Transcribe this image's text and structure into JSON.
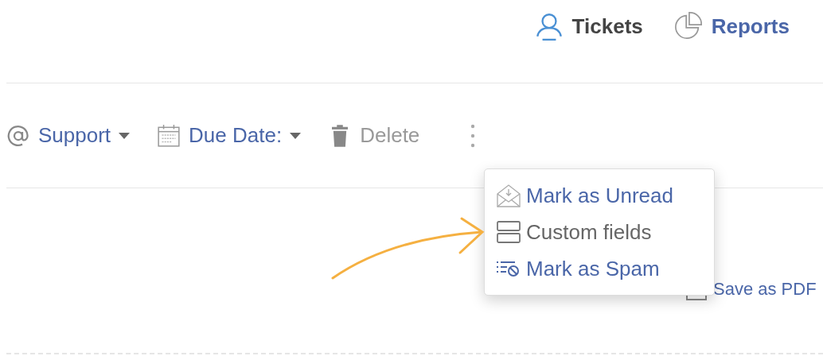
{
  "nav": [
    {
      "label": "Tickets",
      "kind": "person",
      "selected": true
    },
    {
      "label": "Reports",
      "kind": "pie",
      "selected": false
    }
  ],
  "toolbar": [
    {
      "label": "Support",
      "kind": "mailbox",
      "dropdown": true,
      "disabled": false
    },
    {
      "label": "Due Date:",
      "kind": "calendar",
      "dropdown": true,
      "disabled": false
    },
    {
      "label": "Delete",
      "kind": "trash",
      "dropdown": false,
      "disabled": true
    }
  ],
  "menu": {
    "items": [
      {
        "label": "Mark as Unread",
        "kind": "unread"
      },
      {
        "label": "Custom fields",
        "kind": "fields"
      },
      {
        "label": "Mark as Spam",
        "kind": "spam"
      }
    ]
  },
  "save_pdf": {
    "label": "Save as PDF"
  }
}
